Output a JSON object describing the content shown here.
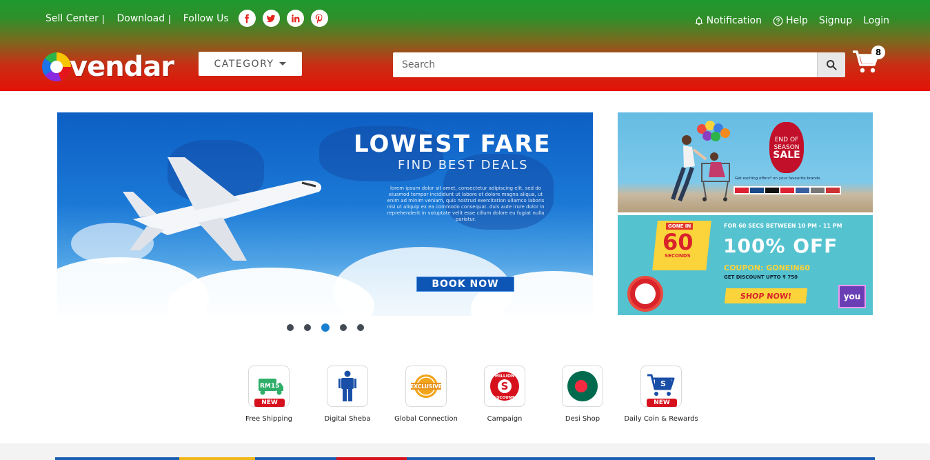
{
  "topbar": {
    "sell_center": "Sell Center",
    "download": "Download",
    "follow_us": "Follow Us",
    "separator": "|",
    "social": [
      {
        "icon": "facebook-icon",
        "glyph": "f"
      },
      {
        "icon": "twitter-icon",
        "glyph": "t"
      },
      {
        "icon": "linkedin-icon",
        "glyph": "in"
      },
      {
        "icon": "pinterest-icon",
        "glyph": "p"
      }
    ],
    "notification": "Notification",
    "help": "Help",
    "signup": "Signup",
    "login": "Login"
  },
  "header": {
    "logo_text": "vendar",
    "category_label": "CATEGORY",
    "search_placeholder": "Search",
    "cart_count": "8"
  },
  "banner": {
    "title": "LOWEST FARE",
    "subtitle": "FIND BEST DEALS",
    "paragraph": "lorem ipsum dolor sit amet, consectetur adipiscing elit, sed do eiusmod tempor incididunt ut labore et dolore magna aliqua, ut enim ad minim veniam, quis nostrud exercitation ullamco laboris nisi ut aliquip ex ea commodo consequat. duis aute irure dolor in reprehenderit in voluptate velit esse cillum dolore eu fugiat nulla pariatur.",
    "cta": "BOOK NOW",
    "slides": 5,
    "active_slide": 3
  },
  "side_banner_1": {
    "tag_line1": "END OF",
    "tag_line2": "SEASON",
    "tag_line3": "SALE",
    "caption": "Get exciting offers* on your favourite brands."
  },
  "side_banner_2": {
    "gone_in": "GONE IN",
    "number": "60",
    "seconds": "SECONDS",
    "headline_small": "FOR 60 SECS BETWEEN 10 PM - 11 PM",
    "headline": "100% OFF",
    "coupon": "COUPON: GONEIN60",
    "discount": "GET DISCOUNT UPTO ₹ 750",
    "cta": "SHOP NOW!",
    "badge": "you"
  },
  "quick_links": [
    {
      "label": "Free Shipping",
      "icon": "truck-icon",
      "new": "NEW"
    },
    {
      "label": "Digital Sheba",
      "icon": "person-icon"
    },
    {
      "label": "Global Connection",
      "icon": "exclusive-badge-icon",
      "badge_text": "EXCLUSIVE"
    },
    {
      "label": "Campaign",
      "icon": "million-discounts-icon",
      "badge_text": "MILLION DISCOUNTS"
    },
    {
      "label": "Desi Shop",
      "icon": "bangladesh-flag-icon"
    },
    {
      "label": "Daily Coin & Rewards",
      "icon": "coin-cart-icon",
      "new": "NEW"
    }
  ],
  "colors": {
    "header_top": "#1f9a2e",
    "header_bottom": "#e51106",
    "active_dot": "#1a7fd0",
    "accent_red": "#d6101c"
  }
}
